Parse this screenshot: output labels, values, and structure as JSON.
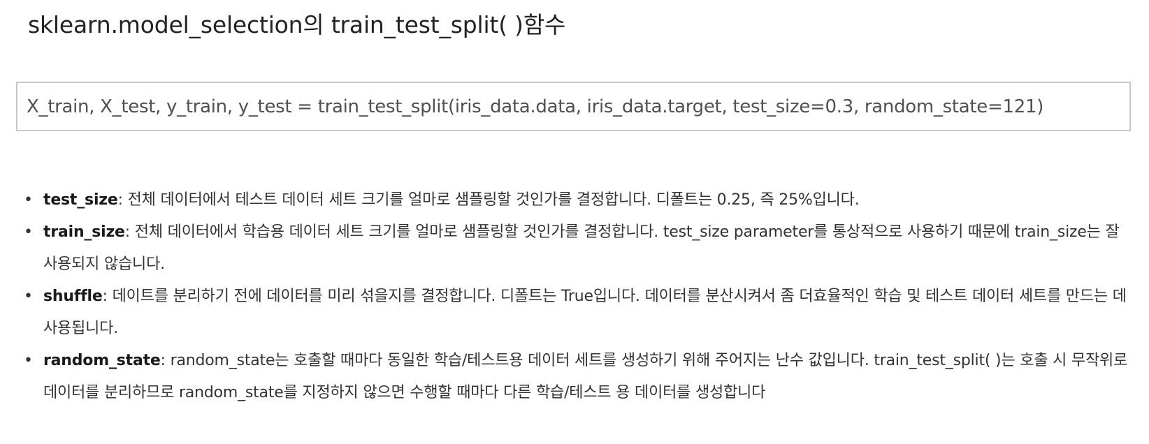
{
  "title": "sklearn.model_selection의 train_test_split( )함수",
  "code": "X_train, X_test, y_train, y_test = train_test_split(iris_data.data, iris_data.target, test_size=0.3, random_state=121)",
  "params": [
    {
      "name": "test_size",
      "desc": ": 전체 데이터에서 테스트 데이터 세트 크기를 얼마로 샘플링할 것인가를 결정합니다. 디폴트는 0.25, 즉 25%입니다."
    },
    {
      "name": "train_size",
      "desc": ": 전체 데이터에서 학습용 데이터 세트 크기를 얼마로 샘플링할 것인가를 결정합니다. test_size parameter를 통상적으로 사용하기 때문에 train_size는 잘 사용되지 않습니다."
    },
    {
      "name": "shuffle",
      "desc": ": 데이트를 분리하기 전에 데이터를 미리 섞을지를 결정합니다. 디폴트는 True입니다. 데이터를 분산시켜서 좀 더효율적인 학습 및 테스트 데이터 세트를 만드는 데 사용됩니다."
    },
    {
      "name": "random_state",
      "desc": ": random_state는 호출할 때마다 동일한 학습/테스트용 데이터 세트를 생성하기 위해 주어지는 난수 값입니다. train_test_split( )는 호출 시 무작위로 데이터를 분리하므로 random_state를 지정하지 않으면 수행할 때마다 다른 학습/테스트 용 데이터를 생성합니다"
    }
  ]
}
